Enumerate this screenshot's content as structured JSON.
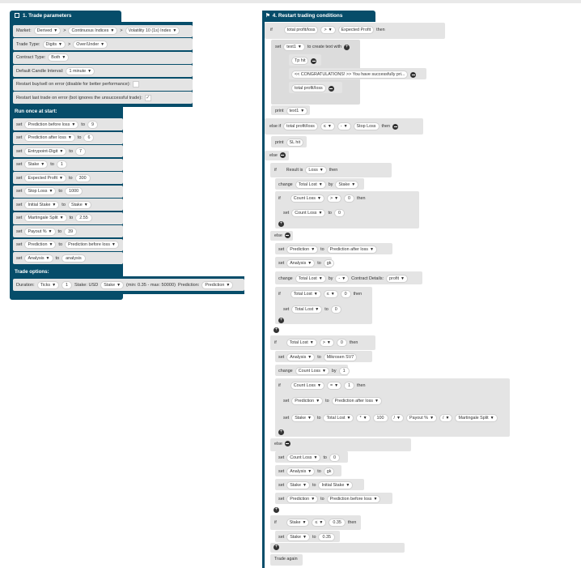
{
  "trade_params": {
    "title": "1. Trade parameters",
    "market_label": "Market:",
    "market": "Derived",
    "submarket": "Continuous Indices",
    "symbol": "Volatility 10 (1s) Index",
    "sep": ">",
    "trade_type_label": "Trade Type:",
    "trade_type": "Digits",
    "trade_subtype": "Over/Under",
    "contract_type_label": "Contract Type:",
    "contract_type": "Both",
    "candle_label": "Default Candle Interval:",
    "candle": "1 minute",
    "restart_buy_label": "Restart buy/sell on error (disable for better performance):",
    "restart_last_label": "Restart last trade on error (bot ignores the unsuccessful trade):"
  },
  "run_once": {
    "title": "Run once at start:",
    "set": "set",
    "to": "to",
    "rows": [
      {
        "var": "Prediction before loss",
        "val": "9"
      },
      {
        "var": "Prediction after loss",
        "val": "6"
      },
      {
        "var": "Entrypoint-Digit",
        "val": "7"
      },
      {
        "var": "Stake",
        "val": "1"
      },
      {
        "var": "Expected Profit",
        "val": "300"
      },
      {
        "var": "Stop Loss",
        "val": "1000"
      },
      {
        "var": "Initial Stake",
        "val": "Stake"
      },
      {
        "var": "Martingale Split",
        "val": "2.55"
      },
      {
        "var": "Payout %",
        "val": "39"
      },
      {
        "var": "Prediction",
        "val": "Prediction before loss"
      },
      {
        "var": "Analysis",
        "val": "analysis"
      }
    ]
  },
  "trade_options": {
    "title": "Trade options:",
    "duration_label": "Duration:",
    "duration_unit": "Ticks",
    "duration_val": "1",
    "stake_label": "Stake: USD",
    "stake_var": "Stake",
    "limits": "(min: 0.35 - max: 50000)",
    "prediction_label": "Prediction:",
    "prediction_var": "Prediction"
  },
  "restart": {
    "title": "4. Restart trading conditions",
    "if": "if",
    "then": "then",
    "set": "set",
    "to": "to",
    "print": "print",
    "else_if": "else if",
    "else": "else",
    "change": "change",
    "by": "by",
    "total_pl": "total profit/loss",
    "gt": ">",
    "eq": "=",
    "le": "≤",
    "mul": "*",
    "div": "/",
    "minus": "-",
    "expected_profit": "Expected Profit",
    "text1": "text1",
    "create_text": "to create text with",
    "tp_hit": "Tp hit",
    "congrats": "<< CONGRATULATIONS! >> You have successfully pri...",
    "stop_loss": "Stop Loss",
    "sl_hit": "SL hit",
    "result_is": "Result is",
    "loss": "Loss",
    "total_lost": "Total Lost",
    "stake": "Stake",
    "count_loss": "Count Loss",
    "zero": "0",
    "one": "1",
    "prediction": "Prediction",
    "pred_after": "Prediction after loss",
    "pred_before": "Prediction before loss",
    "analysis": "Analysis",
    "gk": "gk",
    "contract_details": "Contract Details:",
    "profit": "profit",
    "mikrosen": "Mikrosen SV7",
    "hundred": "100",
    "payout": "Payout %",
    "martingale": "Martingale Split",
    "initial_stake": "Initial Stake",
    "min_stake": "0.35",
    "trade_again": "Trade again"
  }
}
